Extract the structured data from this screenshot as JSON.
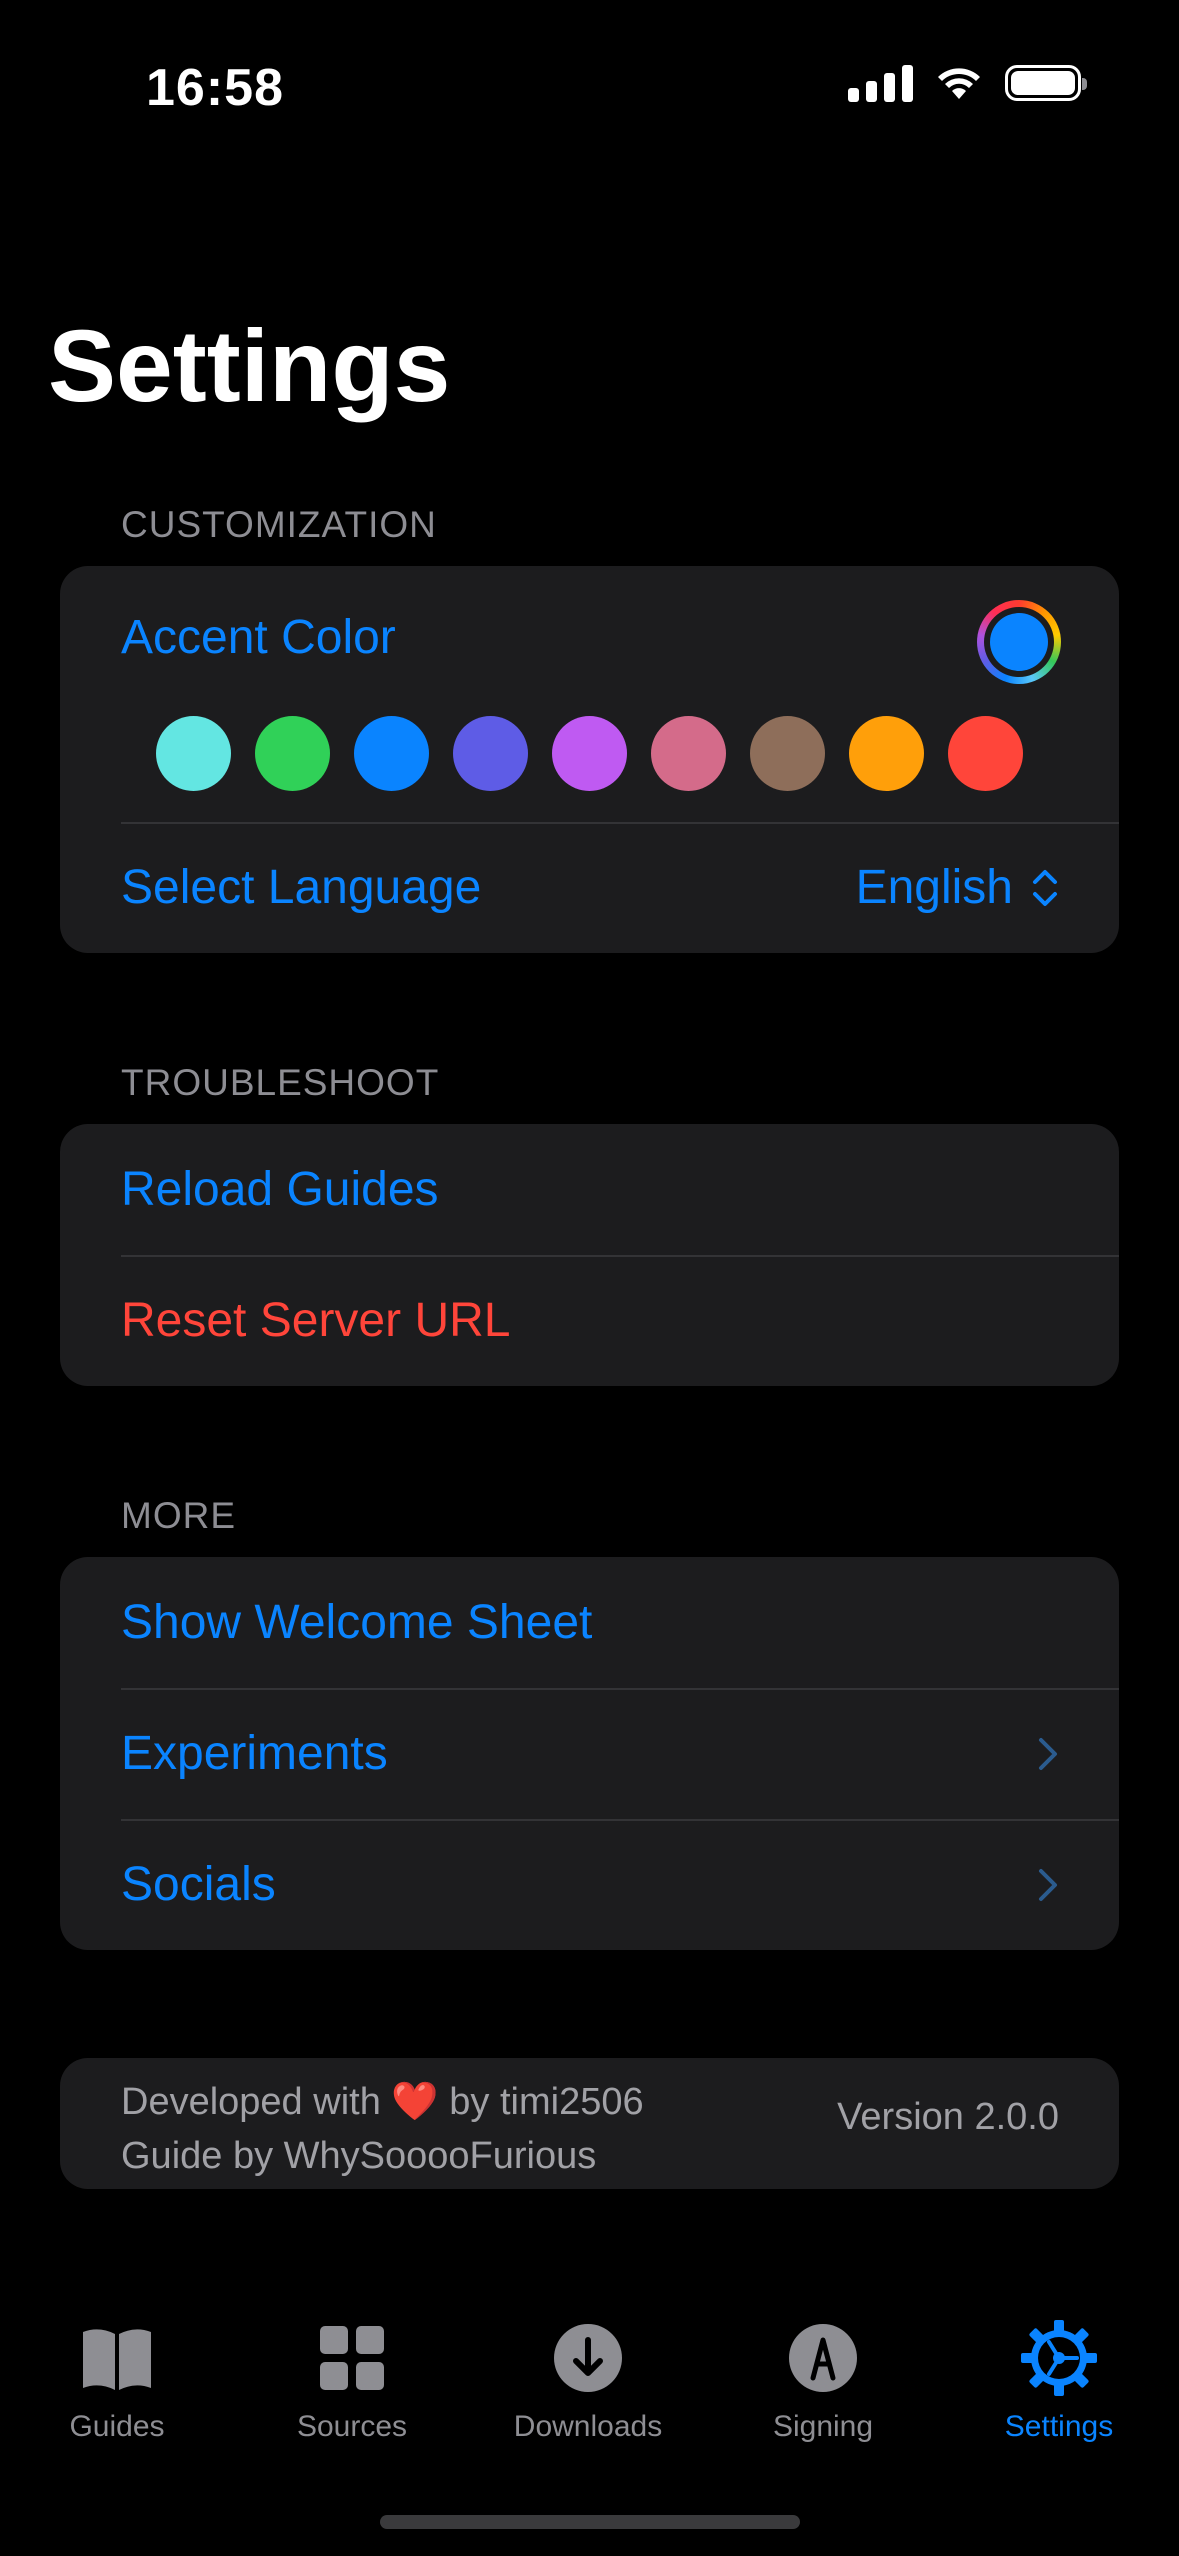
{
  "status": {
    "time": "16:58"
  },
  "title": "Settings",
  "sections": {
    "customization": {
      "header": "CUSTOMIZATION",
      "accent_label": "Accent Color",
      "accent_selected": "#0a84ff",
      "swatches": [
        "#63e6e2",
        "#30d158",
        "#0a84ff",
        "#5e5ce6",
        "#bf5af2",
        "#d46b8a",
        "#8e6e5a",
        "#ff9f0a",
        "#ff453a"
      ],
      "language_label": "Select Language",
      "language_value": "English"
    },
    "troubleshoot": {
      "header": "TROUBLESHOOT",
      "reload_label": "Reload Guides",
      "reset_label": "Reset Server URL"
    },
    "more": {
      "header": "MORE",
      "welcome_label": "Show Welcome Sheet",
      "experiments_label": "Experiments",
      "socials_label": "Socials"
    }
  },
  "footer": {
    "developed_prefix": "Developed with",
    "heart": "❤️",
    "developed_suffix": "by timi2506",
    "guide": "Guide by WhySooooFurious",
    "version": "Version 2.0.0"
  },
  "tabs": [
    {
      "label": "Guides",
      "icon": "book-icon",
      "active": false
    },
    {
      "label": "Sources",
      "icon": "grid-icon",
      "active": false
    },
    {
      "label": "Downloads",
      "icon": "download-circle-icon",
      "active": false
    },
    {
      "label": "Signing",
      "icon": "signature-icon",
      "active": false
    },
    {
      "label": "Settings",
      "icon": "gear-icon",
      "active": true
    }
  ],
  "colors": {
    "accent": "#0a84ff",
    "destructive": "#ff453a",
    "card": "#1c1c1e",
    "inactive_tab": "#8e8e93"
  }
}
